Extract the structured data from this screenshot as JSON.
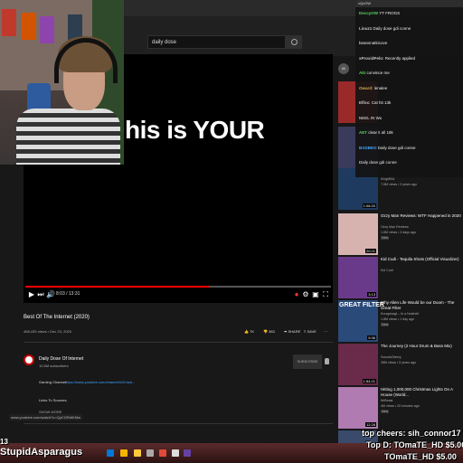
{
  "search": {
    "query": "daily dose"
  },
  "player": {
    "caption": "his is YOUR",
    "time": "8:03 / 13:31",
    "progress": 0.6
  },
  "video": {
    "title": "Best Of The Internet (2020)",
    "meta": "458,439 views • Dec 23, 2020",
    "likes": "7K",
    "dislikes": "363",
    "share": "SHARE",
    "save": "SAVE"
  },
  "channel": {
    "name": "Daily Dose Of Internet",
    "subs": "10.5M subscribers",
    "subscribe": "SUBSCRIBE",
    "gaming_label": "Gaming Channel:",
    "gaming_link": "https://www.youtube.com/channel/UCmzb...",
    "links_label": "Links To Sources:",
    "show_more": "SHOW MORE"
  },
  "sidebar": {
    "toggle": "All",
    "items": [
      {
        "title": "Ozzy Man Reviews: WTF Happened in 2020",
        "channel": "Ozzy Man Reviews",
        "views": "1.6M views • 3 days ago",
        "badge": "New",
        "duration": "20:21",
        "color": "#d7b3b0"
      },
      {
        "title": "Kid Cudi - Tequila Shots (Official Visualizer)",
        "channel": "Kid Cudi",
        "views": "",
        "badge": "",
        "duration": "3:13",
        "color": "#6a3a8a"
      },
      {
        "title": "Why Alien Life Would be our Doom - The Great Filter",
        "channel": "Kurzgesagt – In a Nutshell",
        "views": "1.8M views • 1 day ago",
        "badge": "New",
        "duration": "9:36",
        "color": "#2a4a7a"
      },
      {
        "title": "The Journey (2 Hour Drum & Bass Mix)",
        "channel": "SoundsSteery",
        "views": "28M views • 5 years ago",
        "badge": "",
        "duration": "1:54:21",
        "color": "#6a2a4a"
      },
      {
        "title": "Hitting 1,000,000 Christmas Lights On A House (World...",
        "channel": "MrBeast",
        "views": "4M views • 20 minutes ago",
        "badge": "New",
        "duration": "12:28",
        "color": "#b07bb0"
      },
      {
        "title": "",
        "channel": "",
        "views": "",
        "badge": "",
        "duration": "",
        "color": "#3a4a6a"
      }
    ],
    "partial_top": {
      "channel": "KingMiNL",
      "views": "7.6M views • 3 years ago",
      "duration": "1:06:20"
    },
    "partial_top2": {
      "channel": "SUPER SUBSCRIBE MIYA",
      "views": "",
      "duration": ""
    }
  },
  "sidebar_extra": {
    "great_filter_title": "GREAT FILTER"
  },
  "chat": {
    "header": "xQcOW",
    "messages": [
      {
        "user": "DeccyOW",
        "text": "YT FROGS",
        "color": "#57d45b"
      },
      {
        "user": "Liouz1",
        "text": "Daily dose gdi conne",
        "color": "#c7c7c7"
      },
      {
        "user": "",
        "text": "beansnatkicove",
        "color": "#3ea6ff"
      },
      {
        "user": "xProxidPelo:",
        "text": "Recently applied",
        "color": "#c7c7c7"
      },
      {
        "user": "Akt",
        "text": "convince me",
        "color": "#57d45b"
      },
      {
        "user": "Oward:",
        "text": "lenalee",
        "color": "#d4a94f"
      },
      {
        "user": "Elfox:",
        "text": "Cat hit 13k",
        "color": "#c7c7c7"
      },
      {
        "user": "",
        "text": "NEEL IN Wu",
        "color": "#c7c7c7"
      },
      {
        "user": "AET",
        "text": "clear it all 18k",
        "color": "#57d45b"
      },
      {
        "user": "BADBEO",
        "text": "Daily dose gdi conne",
        "color": "#3ea6ff"
      },
      {
        "user": "",
        "text": "Daily dose gdi conne",
        "color": "#c7c7c7"
      }
    ]
  },
  "status_url": "www.youtube.com/watch?v=QpCGRdIKMw",
  "overlay": {
    "sub_count": "13",
    "sub_name": "StupidAsparagus",
    "top_donor_line1": "top cheers: sih_connor17 500",
    "top_donor_line2": "Top D: TOmaTE_HD $5.00",
    "top_donor_line3": "TOmaTE_HD $5.00"
  },
  "colors": {
    "accent": "#ff0000",
    "link": "#3ea6ff"
  }
}
